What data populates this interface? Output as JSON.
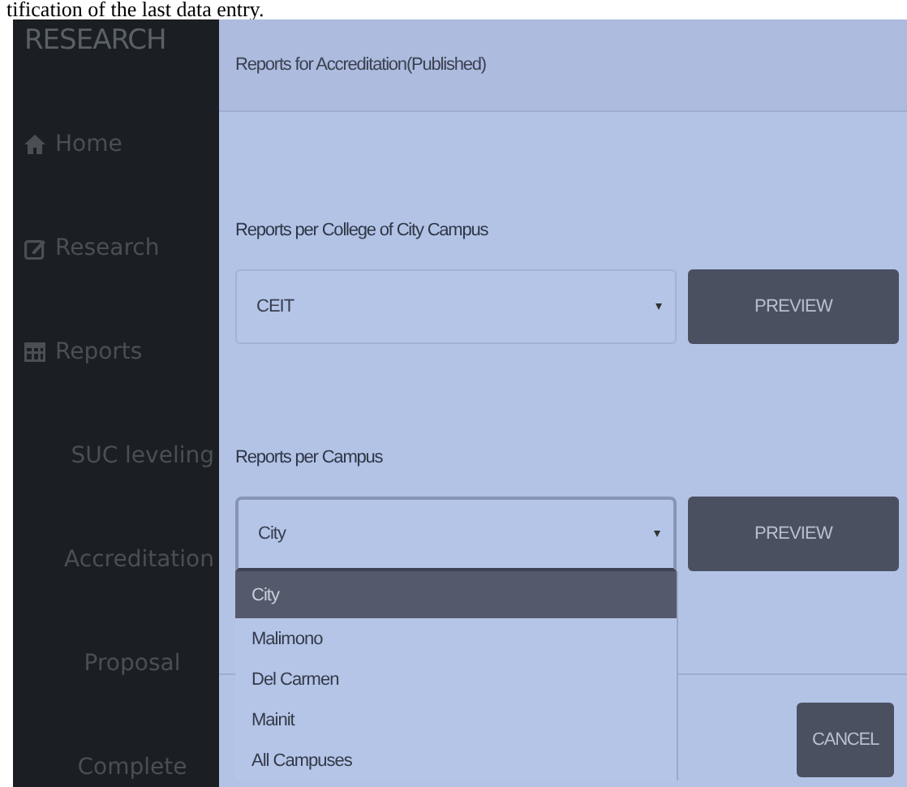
{
  "document_text": "tification of the last data entry.",
  "sidebar": {
    "brand": "RESEARCH",
    "items": [
      {
        "label": "Home"
      },
      {
        "label": "Research"
      },
      {
        "label": "Reports",
        "children": [
          {
            "label": "SUC leveling"
          },
          {
            "label": "Accreditation",
            "children": [
              {
                "label": "Proposal"
              },
              {
                "label": "Complete"
              }
            ]
          }
        ]
      }
    ]
  },
  "main": {
    "header": "Reports for Accreditation(Published)",
    "sections": [
      {
        "label": "Reports per College of City Campus",
        "value": "CEIT",
        "button": "PREVIEW",
        "expanded": false
      },
      {
        "label": "Reports per Campus",
        "value": "City",
        "button": "PREVIEW",
        "expanded": true,
        "options": [
          {
            "label": "City",
            "selected": true
          },
          {
            "label": "Malimono",
            "selected": false
          },
          {
            "label": "Del Carmen",
            "selected": false
          },
          {
            "label": "Mainit",
            "selected": false
          },
          {
            "label": "All Campuses",
            "selected": false
          }
        ]
      }
    ],
    "cancel": "CANCEL"
  }
}
